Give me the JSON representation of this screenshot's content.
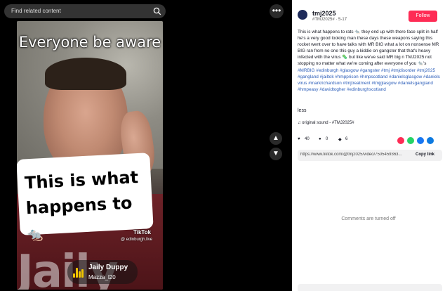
{
  "search": {
    "placeholder": "Find related content"
  },
  "video": {
    "overlay_top": "Everyone be aware",
    "caption": "This is what happens to",
    "caption_emoji": "🐀",
    "shirt_text": "Jaily",
    "tiktok_mark": "TikTok",
    "tiktok_handle": "@ edinburgh.live",
    "music_title": "Jaily Duppy",
    "music_artist": "Mazza_l20"
  },
  "panel": {
    "author": "tmj2025",
    "author_sub": "#TMJ2025# · 5-17",
    "follow_label": "Follow",
    "description_text": "This is what happens to rats 🐀 they end up with there face split in half he's a very good looking man these days these weapons saying this rocket went over to have talks with MR BIG what a lot on nonsense MR BIG ran from no one this guy a kiddie on gangster that that's heavy infected with the virus 🦠 but like we've said MR big n TMJ2025 not stopping no matter what we're coming after everyone of you 🐀's ",
    "hashtags": "#MRBIG #edinburgh #glasgow #gangster #tmj #tmjdisorder #tmj2025 #gangland #jailtok #hmpprison #hmpscotland #danielsglasgow #daniels​virus #markrichardson #tmjtreatment #tmjglasgow #danielsgangland #hmpeasy #davidtogher #edinburghscotland",
    "less_label": "less",
    "sound_label": "original sound - #TMJ2025#",
    "likes": "40",
    "comments": "0",
    "saves": "6",
    "share_colors": [
      "#fe2c55",
      "#25d366",
      "#1877f2",
      "#0d7ae0"
    ],
    "link_url": "https://www.tiktok.com/@tmj2025/video/7505459363...",
    "copy_link_label": "Copy link",
    "comments_off": "Comments are turned off"
  },
  "icons": [
    "search-icon",
    "more-icon",
    "chevron-up-icon",
    "chevron-down-icon",
    "music-note-icon",
    "heart-icon",
    "comment-icon",
    "bookmark-icon"
  ]
}
